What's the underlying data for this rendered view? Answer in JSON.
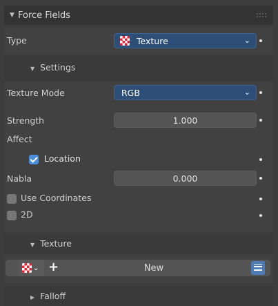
{
  "panel": {
    "title": "Force Fields"
  },
  "type_row": {
    "label": "Type",
    "value": "Texture",
    "icon": "texture-checker-icon"
  },
  "settings": {
    "title": "Settings"
  },
  "texture_mode": {
    "label": "Texture Mode",
    "value": "RGB"
  },
  "strength": {
    "label": "Strength",
    "value": "1.000"
  },
  "affect": {
    "label": "Affect"
  },
  "location": {
    "label": "Location",
    "checked": true
  },
  "nabla": {
    "label": "Nabla",
    "value": "0.000"
  },
  "use_coordinates": {
    "label": "Use Coordinates",
    "checked": false
  },
  "two_d": {
    "label": "2D",
    "checked": false
  },
  "texture_sub": {
    "title": "Texture",
    "new_label": "New"
  },
  "falloff": {
    "title": "Falloff"
  },
  "colors": {
    "accent": "#2c4e77",
    "checkbox_on": "#4a8fd9",
    "texture_icon": "#e23333"
  }
}
